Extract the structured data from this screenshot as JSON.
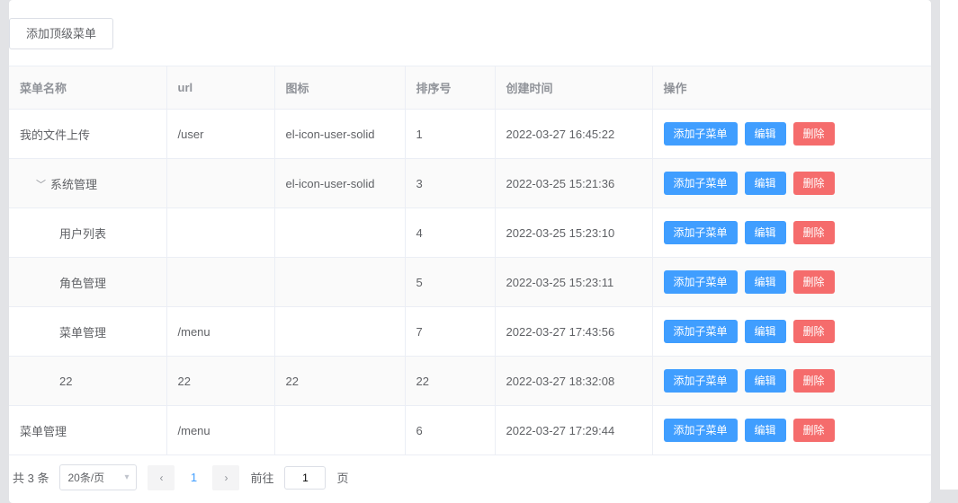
{
  "toolbar": {
    "add_top_menu": "添加顶级菜单"
  },
  "columns": {
    "name": "菜单名称",
    "url": "url",
    "icon": "图标",
    "sort": "排序号",
    "created": "创建时间",
    "ops": "操作"
  },
  "actions": {
    "add_child": "添加子菜单",
    "edit": "编辑",
    "delete": "删除"
  },
  "rows": [
    {
      "name": "我的文件上传",
      "url": "/user",
      "icon": "el-icon-user-solid",
      "sort": "1",
      "created": "2022-03-27 16:45:22",
      "indent": 0,
      "expandable": false
    },
    {
      "name": "系统管理",
      "url": "",
      "icon": "el-icon-user-solid",
      "sort": "3",
      "created": "2022-03-25 15:21:36",
      "indent": 1,
      "expandable": true
    },
    {
      "name": "用户列表",
      "url": "",
      "icon": "",
      "sort": "4",
      "created": "2022-03-25 15:23:10",
      "indent": 2,
      "expandable": false
    },
    {
      "name": "角色管理",
      "url": "",
      "icon": "",
      "sort": "5",
      "created": "2022-03-25 15:23:11",
      "indent": 2,
      "expandable": false
    },
    {
      "name": "菜单管理",
      "url": "/menu",
      "icon": "",
      "sort": "7",
      "created": "2022-03-27 17:43:56",
      "indent": 2,
      "expandable": false
    },
    {
      "name": "22",
      "url": "22",
      "icon": "22",
      "sort": "22",
      "created": "2022-03-27 18:32:08",
      "indent": 2,
      "expandable": false
    },
    {
      "name": "菜单管理",
      "url": "/menu",
      "icon": "",
      "sort": "6",
      "created": "2022-03-27 17:29:44",
      "indent": 0,
      "expandable": false
    }
  ],
  "pagination": {
    "total_label": "共 3 条",
    "page_size_label": "20条/页",
    "current_page": "1",
    "jump_prefix": "前往",
    "jump_value": "1",
    "jump_suffix": "页"
  }
}
